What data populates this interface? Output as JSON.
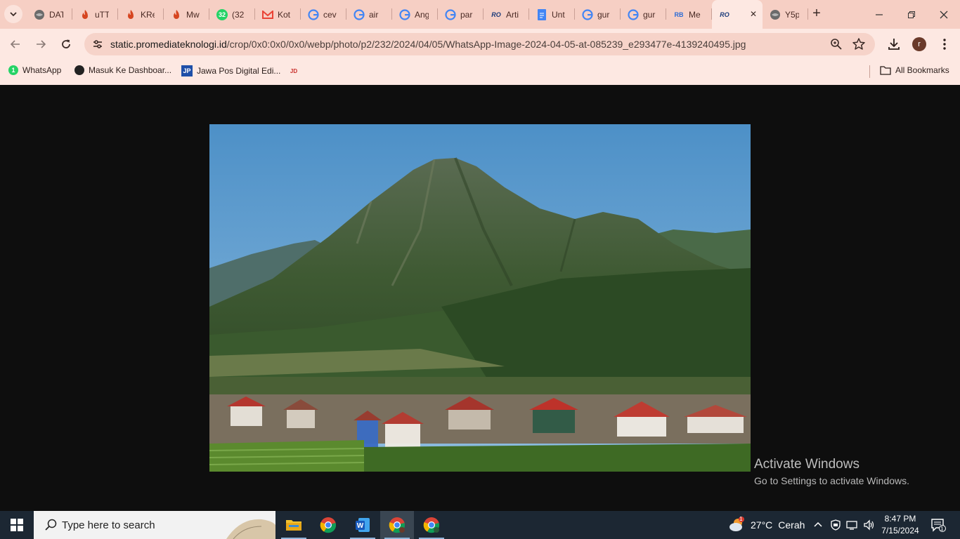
{
  "browser": {
    "tabs": [
      {
        "title": "DAT",
        "icon": "globe-icon",
        "color": "#6b6b6b"
      },
      {
        "title": "uTT",
        "icon": "flame-icon",
        "color": "#d64520"
      },
      {
        "title": "KRe",
        "icon": "flame-icon",
        "color": "#d64520"
      },
      {
        "title": "Mw",
        "icon": "flame-icon",
        "color": "#d64520"
      },
      {
        "title": "(32",
        "icon": "whatsapp-icon",
        "color": "#25d366",
        "badge": "32"
      },
      {
        "title": "Kot",
        "icon": "gmail-icon",
        "color": "#ea4335"
      },
      {
        "title": "cev",
        "icon": "google-icon",
        "color": "#4285f4"
      },
      {
        "title": "air",
        "icon": "google-icon",
        "color": "#4285f4"
      },
      {
        "title": "Ang",
        "icon": "google-icon",
        "color": "#4285f4"
      },
      {
        "title": "par",
        "icon": "google-icon",
        "color": "#4285f4"
      },
      {
        "title": "Arti",
        "icon": "ro-icon",
        "color": "#1a3a7a"
      },
      {
        "title": "Unt",
        "icon": "docs-icon",
        "color": "#4285f4"
      },
      {
        "title": "gur",
        "icon": "google-icon",
        "color": "#4285f4"
      },
      {
        "title": "gur",
        "icon": "google-icon",
        "color": "#4285f4"
      },
      {
        "title": "Me",
        "icon": "rb-icon",
        "color": "#2b6cd6"
      },
      {
        "title": "",
        "icon": "ro-icon",
        "color": "#1a3a7a",
        "active": true
      },
      {
        "title": "Y5p",
        "icon": "globe-icon",
        "color": "#6b6b6b"
      }
    ],
    "url": {
      "host": "static.promediateknologi.id",
      "path": "/crop/0x0:0x0/0x0/webp/photo/p2/232/2024/04/05/WhatsApp-Image-2024-04-05-at-085239_e293477e-4139240495.jpg"
    },
    "profile_initial": "r",
    "bookmarks": [
      {
        "label": "WhatsApp",
        "icon": "whatsapp-icon"
      },
      {
        "label": "Masuk Ke Dashboar...",
        "icon": "globe-dark-icon"
      },
      {
        "label": "Jawa Pos Digital Edi...",
        "icon": "jp-icon"
      },
      {
        "label": "",
        "icon": "jdih-icon"
      }
    ],
    "all_bookmarks_label": "All Bookmarks"
  },
  "content": {
    "image_alt": "mountain landscape with village",
    "watermark": {
      "title": "Activate Windows",
      "subtitle": "Go to Settings to activate Windows."
    }
  },
  "taskbar": {
    "search_placeholder": "Type here to search",
    "weather": {
      "temp": "27°C",
      "condition": "Cerah",
      "badge": "1"
    },
    "time": "8:47 PM",
    "date": "7/15/2024",
    "notification_count": "1"
  },
  "colors": {
    "tabbar": "#f6cfc4",
    "toolbar": "#fde8e2",
    "omnibox": "#f6d3c9",
    "viewport": "#0e0e0e",
    "taskbar": "#1c2733"
  }
}
